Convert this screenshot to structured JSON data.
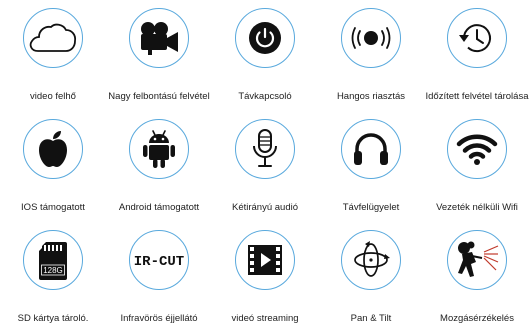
{
  "features": [
    {
      "label": "video felhő",
      "icon": "cloud-icon"
    },
    {
      "label": "Nagy felbontású felvétel",
      "icon": "video-camera-icon"
    },
    {
      "label": "Távkapcsoló",
      "icon": "power-icon"
    },
    {
      "label": "Hangos riasztás",
      "icon": "alarm-icon"
    },
    {
      "label": "Időzített felvétel tárolása",
      "icon": "history-icon"
    },
    {
      "label": "IOS támogatott",
      "icon": "apple-icon"
    },
    {
      "label": "Android támogatott",
      "icon": "android-icon"
    },
    {
      "label": "Kétirányú audió",
      "icon": "microphone-icon"
    },
    {
      "label": "Távfelügyelet",
      "icon": "headphones-icon"
    },
    {
      "label": "Vezeték nélküli Wifi",
      "icon": "wifi-icon"
    },
    {
      "label": "SD kártya tároló.",
      "icon": "sd-card-icon",
      "icon_text": "128G"
    },
    {
      "label": "Infravörös éjjellátó",
      "icon": "ir-cut-icon",
      "icon_text": "IR-CUT"
    },
    {
      "label": "videó streaming",
      "icon": "video-streaming-icon"
    },
    {
      "label": "Pan & Tilt",
      "icon": "pan-tilt-icon"
    },
    {
      "label": "Mozgásérzékelés",
      "icon": "motion-detection-icon"
    }
  ],
  "colors": {
    "ring": "#59a9dd",
    "icon": "#111111",
    "text": "#222222"
  }
}
